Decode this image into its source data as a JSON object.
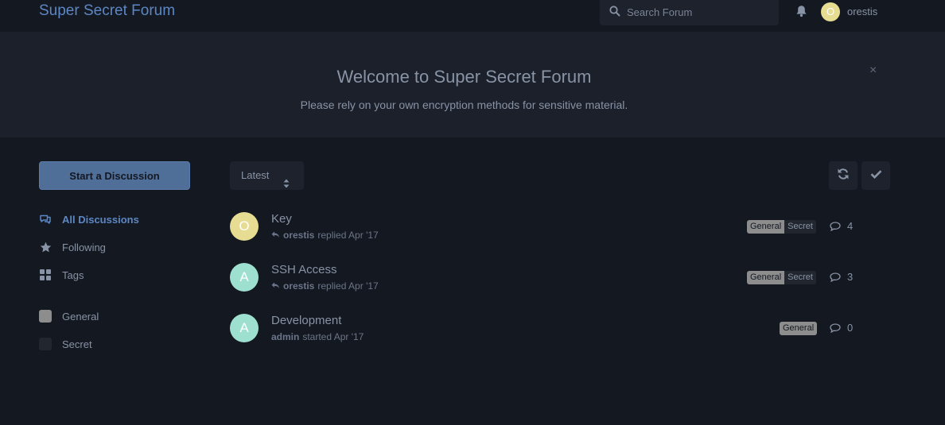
{
  "header": {
    "brand": "Super Secret Forum",
    "search_placeholder": "Search Forum",
    "user": {
      "initial": "O",
      "name": "orestis"
    }
  },
  "hero": {
    "title": "Welcome to Super Secret Forum",
    "subtitle": "Please rely on your own encryption methods for sensitive material.",
    "close": "×"
  },
  "sidebar": {
    "start_button": "Start a Discussion",
    "nav": [
      {
        "label": "All Discussions",
        "icon": "comments-icon",
        "active": true
      },
      {
        "label": "Following",
        "icon": "star-icon"
      },
      {
        "label": "Tags",
        "icon": "tags-grid-icon"
      }
    ],
    "tags": [
      {
        "label": "General",
        "color": "#8d8d8d"
      },
      {
        "label": "Secret",
        "color": "#22272f"
      }
    ]
  },
  "toolbar": {
    "sort_label": "Latest"
  },
  "discussions": [
    {
      "avatar": "O",
      "avatar_color": "#e6dc92",
      "title": "Key",
      "author": "orestis",
      "action": "replied Apr '17",
      "tags": [
        "General",
        "Secret"
      ],
      "count": "4"
    },
    {
      "avatar": "A",
      "avatar_color": "#9ee0cf",
      "title": "SSH Access",
      "author": "orestis",
      "action": "replied Apr '17",
      "tags": [
        "General",
        "Secret"
      ],
      "count": "3"
    },
    {
      "avatar": "A",
      "avatar_color": "#9ee0cf",
      "title": "Development",
      "author": "admin",
      "action": "started Apr '17",
      "tags": [
        "General"
      ],
      "count": "0"
    }
  ]
}
